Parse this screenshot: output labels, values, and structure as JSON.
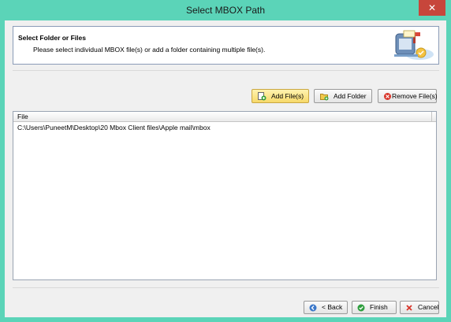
{
  "window": {
    "title": "Select MBOX Path",
    "close_glyph": "✕"
  },
  "header": {
    "title": "Select Folder or Files",
    "description": "Please select individual MBOX file(s) or add a folder containing multiple file(s)."
  },
  "toolbar": {
    "add_files_label": "Add File(s)",
    "add_folder_label": "Add Folder",
    "remove_files_label": "Remove File(s)"
  },
  "file_list": {
    "column_header": "File",
    "rows": [
      "C:\\Users\\PuneetM\\Desktop\\20 Mbox Client files\\Apple mail\\mbox"
    ]
  },
  "footer": {
    "back_label": "< Back",
    "finish_label": "Finish",
    "cancel_label": "Cancel"
  },
  "colors": {
    "title_bar": "#5bd4b8",
    "close_button": "#c7463b",
    "active_button": "#f7d96a"
  },
  "icons": {
    "header": "mailbox-icon",
    "add_files": "add-file-icon",
    "add_folder": "add-folder-icon",
    "remove_files": "remove-icon",
    "back": "back-arrow-icon",
    "finish": "check-icon",
    "cancel": "cancel-icon"
  }
}
